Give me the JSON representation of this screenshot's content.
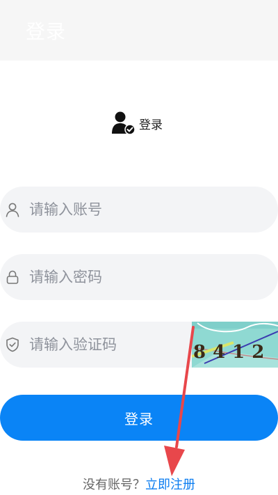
{
  "header": {
    "title": "登录"
  },
  "brand": {
    "label": "登录",
    "icon": "user-check-icon"
  },
  "form": {
    "account_placeholder": "请输入账号",
    "password_placeholder": "请输入密码",
    "captcha_placeholder": "请输入验证码",
    "captcha_text": "8412",
    "submit_label": "登录"
  },
  "footer": {
    "prompt": "没有账号？",
    "register_link": "立即注册"
  },
  "colors": {
    "primary": "#0a84f6",
    "field_bg": "#f3f4f6",
    "annotation": "#e8474b"
  }
}
